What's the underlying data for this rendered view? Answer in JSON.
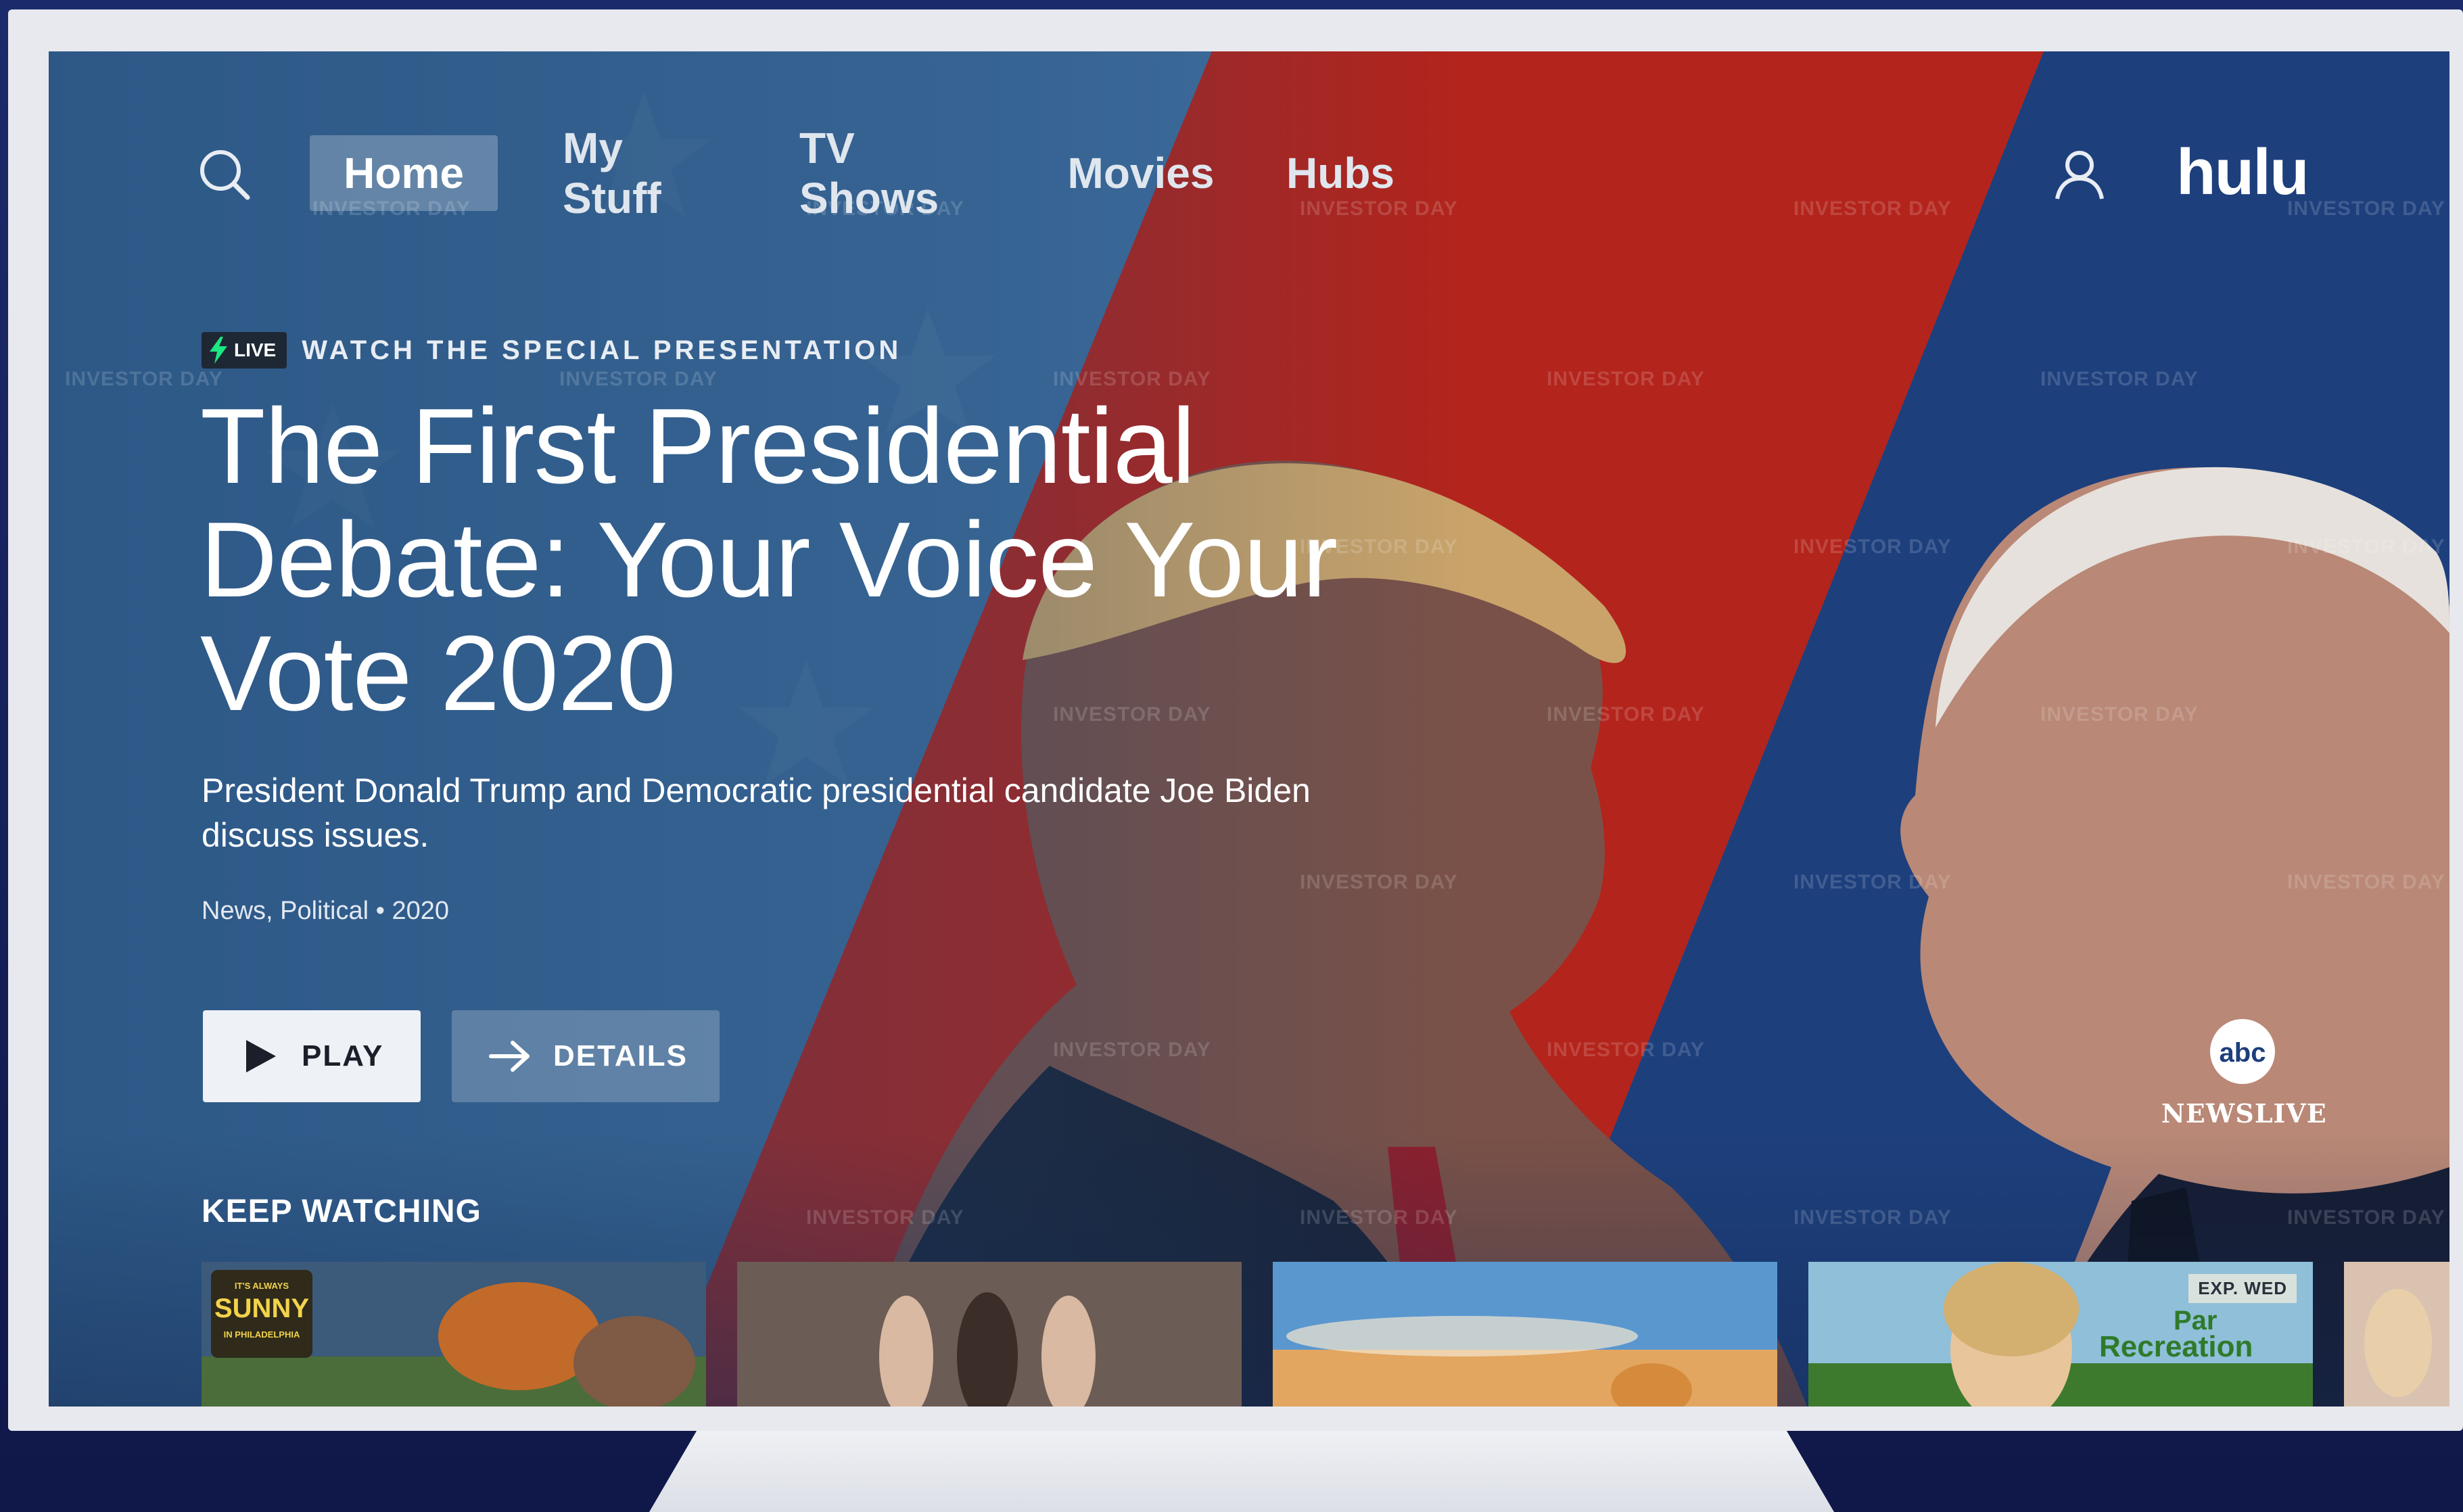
{
  "nav": {
    "tabs": [
      {
        "label": "Home",
        "active": true
      },
      {
        "label": "My Stuff",
        "active": false
      },
      {
        "label": "TV Shows",
        "active": false
      },
      {
        "label": "Movies",
        "active": false
      },
      {
        "label": "Hubs",
        "active": false
      }
    ],
    "logo": "hulu",
    "search_icon": "search-icon",
    "profile_icon": "user-icon"
  },
  "hero": {
    "live_badge": "LIVE",
    "eyebrow": "WATCH THE SPECIAL PRESENTATION",
    "title": "The First Presidential Debate: Your Voice Your Vote 2020",
    "description": "President Donald Trump and Democratic presidential candidate Joe Biden discuss issues.",
    "meta": "News, Political • 2020",
    "play_label": "PLAY",
    "details_label": "DETAILS",
    "network_logo": "abc",
    "network_text": "NEWSLIVE"
  },
  "keep_watching": {
    "title": "KEEP WATCHING",
    "items": [
      {
        "name": "It's Always Sunny in Philadelphia",
        "logo_text": "IT'S ALWAYS SUNNY IN PHILADELPHIA"
      },
      {
        "name": "reality-show"
      },
      {
        "name": "sky-landscape"
      },
      {
        "name": "Parks and Recreation",
        "logo_text": "Parks Recreation",
        "badge": "EXP. WED"
      },
      {
        "name": "partial-item"
      }
    ]
  },
  "watermark": "INVESTOR DAY",
  "colors": {
    "red_panel": "#b3241c",
    "blue_panel": "#1d3f7c",
    "left_panel": "#3f6e9e",
    "hulu_white": "#ffffff",
    "live_bolt": "#1ce783"
  }
}
